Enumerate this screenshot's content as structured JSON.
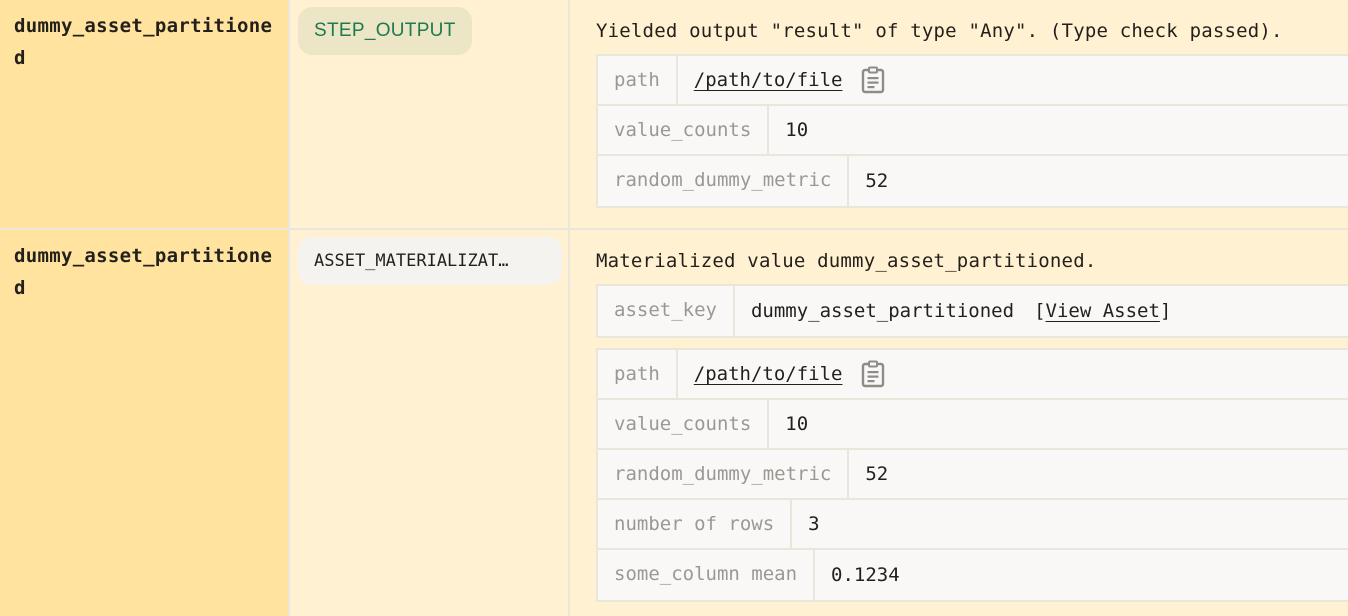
{
  "rows": [
    {
      "step_key": "dummy_asset_partitioned",
      "event_type": "STEP_OUTPUT",
      "message": "Yielded output \"result\" of type \"Any\". (Type check passed).",
      "metadata": [
        {
          "key": "path",
          "value": "/path/to/file",
          "icon": "clipboard-icon"
        },
        {
          "key": "value_counts",
          "value": "10"
        },
        {
          "key": "random_dummy_metric",
          "value": "52"
        }
      ]
    },
    {
      "step_key": "dummy_asset_partitioned",
      "event_type": "ASSET_MATERIALIZAT…",
      "message": "Materialized value dummy_asset_partitioned.",
      "asset_table": {
        "key": "asset_key",
        "value": "dummy_asset_partitioned",
        "link_open": "[",
        "link_label": "View Asset",
        "link_close": "]"
      },
      "metadata": [
        {
          "key": "path",
          "value": "/path/to/file",
          "icon": "clipboard-icon"
        },
        {
          "key": "value_counts",
          "value": "10"
        },
        {
          "key": "random_dummy_metric",
          "value": "52"
        },
        {
          "key": "number of rows",
          "value": "3"
        },
        {
          "key": "some_column mean",
          "value": "0.1234"
        }
      ]
    }
  ],
  "colors": {
    "step_column_bg": "#ffe39f",
    "row_bg": "#fff1d1",
    "output_pill_bg": "#ece6c6",
    "output_pill_text": "#1f7a4f",
    "materialize_pill_bg": "#f5f3f0",
    "meta_table_bg": "#f9f8f6",
    "border": "#ebe6dc",
    "meta_key_text": "#9b9893"
  }
}
